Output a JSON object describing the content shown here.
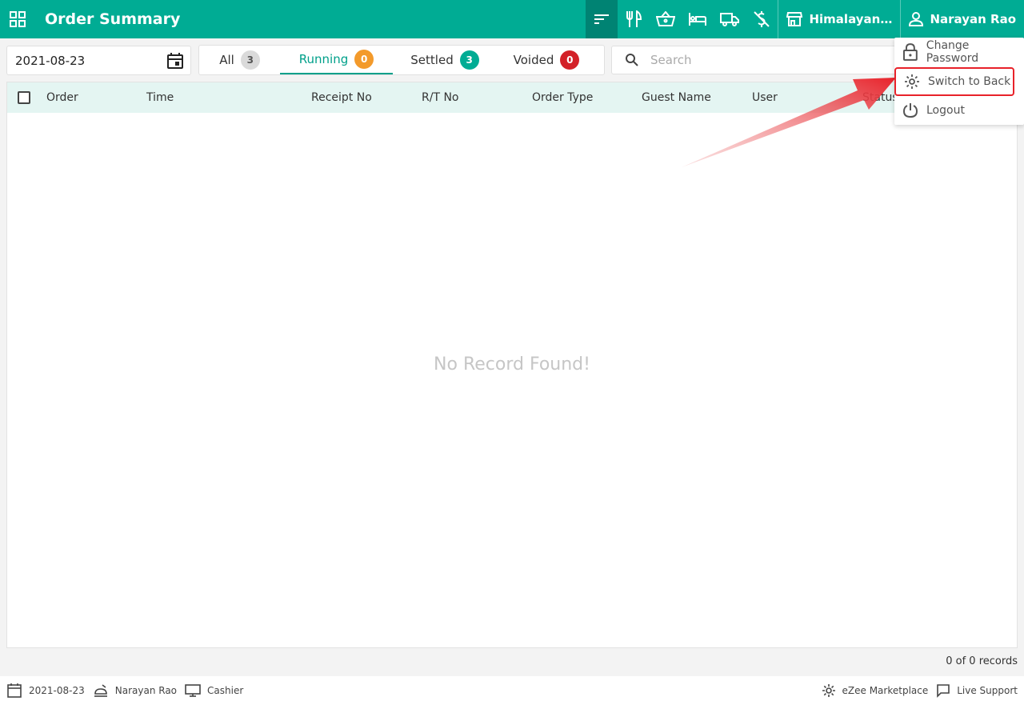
{
  "header": {
    "title": "Order Summary",
    "property": "Himalayan Kitchen",
    "user": "Narayan Rao"
  },
  "toolbar": {
    "date": "2021-08-23",
    "search_placeholder": "Search",
    "tabs": [
      {
        "label": "All",
        "count": "3",
        "color": "#d9d9d9"
      },
      {
        "label": "Running",
        "count": "0",
        "color": "#f39a2b"
      },
      {
        "label": "Settled",
        "count": "3",
        "color": "#00ac94"
      },
      {
        "label": "Voided",
        "count": "0",
        "color": "#d32128"
      }
    ]
  },
  "table": {
    "columns": [
      "Order",
      "Time",
      "Receipt No",
      "R/T No",
      "Order Type",
      "Guest Name",
      "User",
      "Status"
    ],
    "empty_message": "No Record Found!"
  },
  "records_text": "0 of 0 records",
  "footer": {
    "date": "2021-08-23",
    "user": "Narayan Rao",
    "role": "Cashier",
    "marketplace": "eZee Marketplace",
    "support": "Live Support"
  },
  "dropdown": {
    "items": [
      "Change Password",
      "Switch to Back",
      "Logout"
    ]
  },
  "colors": {
    "primary": "#00ac94",
    "primary_dark": "#008373",
    "header_row": "#e4f5f2",
    "highlight": "#e8222a"
  },
  "icons": [
    "apps-grid-icon",
    "sort-icon",
    "cutlery-icon",
    "basket-icon",
    "bed-icon",
    "truck-icon",
    "no-money-icon",
    "store-icon",
    "user-icon",
    "calendar-icon",
    "search-icon",
    "lock-icon",
    "gear-icon",
    "power-icon",
    "chat-icon",
    "monitor-icon",
    "food-tray-icon"
  ]
}
